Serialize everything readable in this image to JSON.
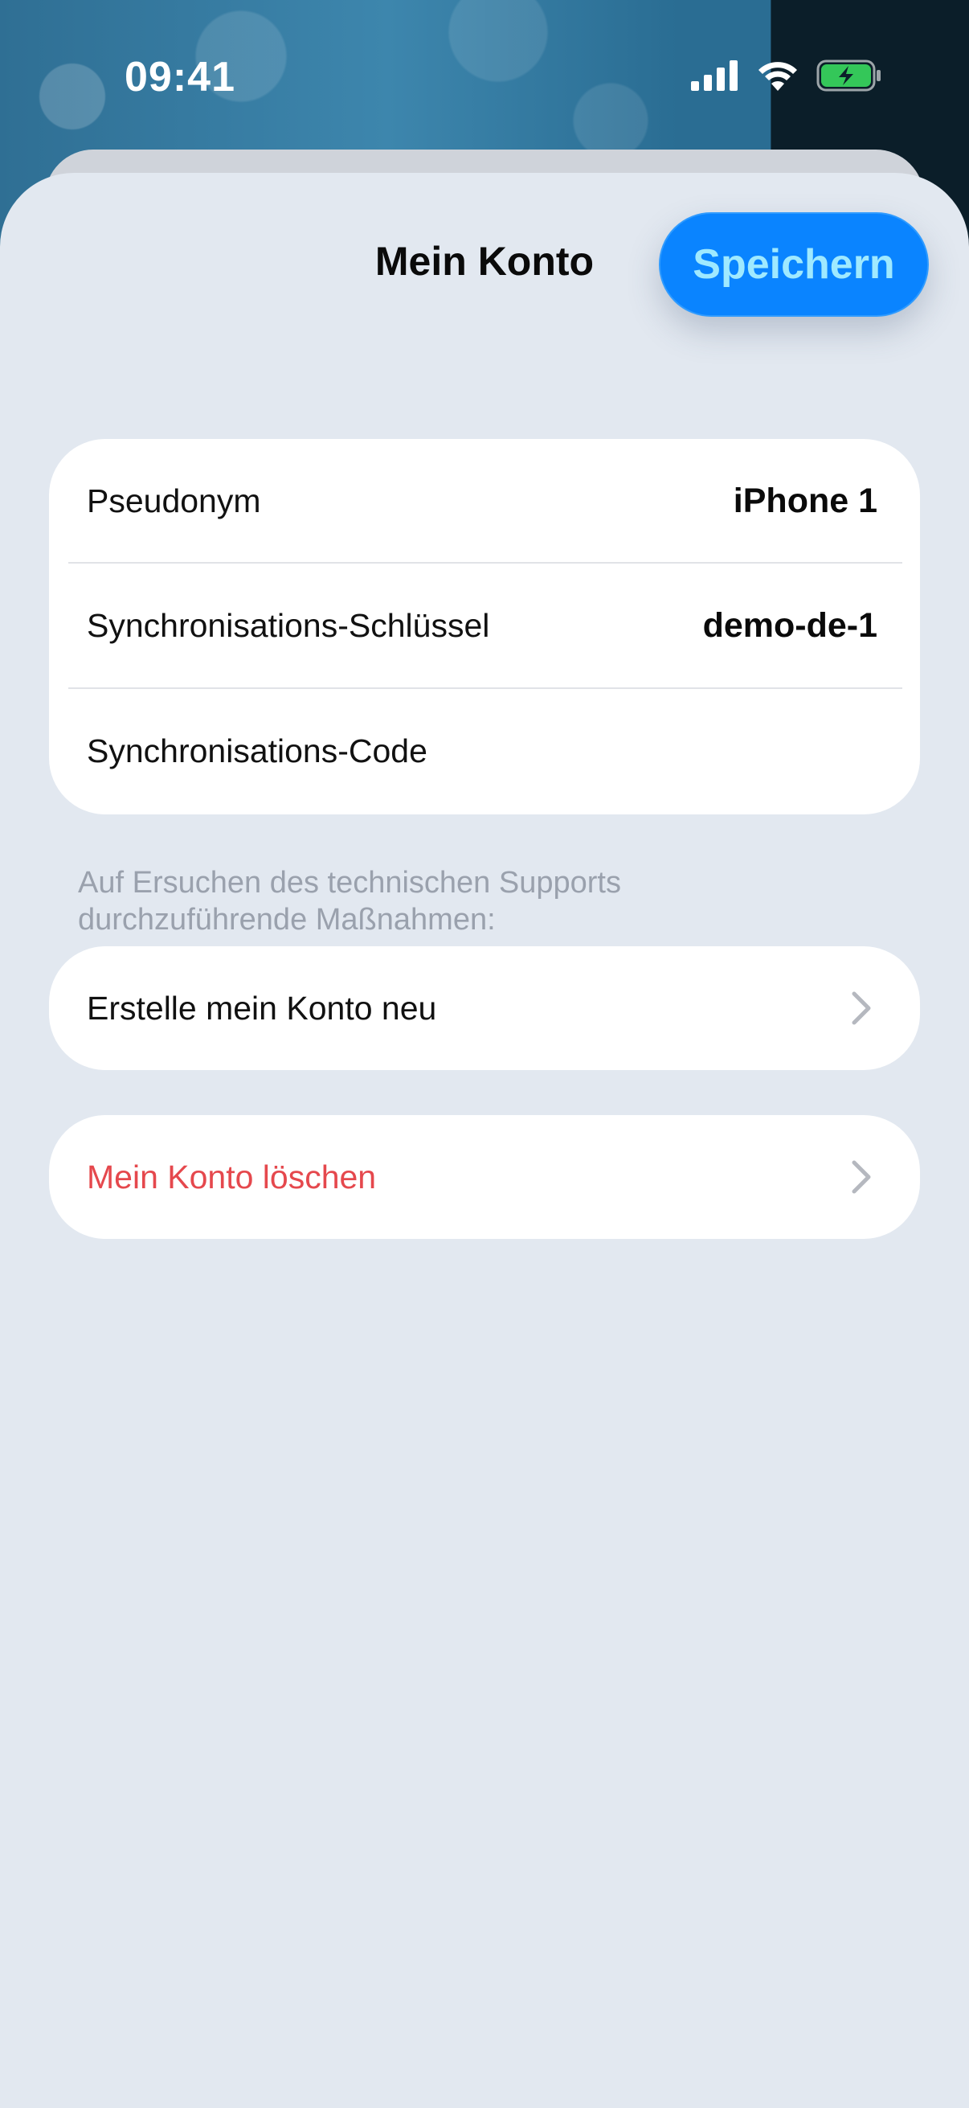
{
  "status_bar": {
    "time": "09:41",
    "icons": [
      "cellular-signal-icon",
      "wifi-icon",
      "battery-charging-icon"
    ]
  },
  "sheet": {
    "title": "Mein Konto",
    "save_label": "Speichern"
  },
  "info_rows": [
    {
      "label": "Pseudonym",
      "value": "iPhone 1"
    },
    {
      "label": "Synchronisations-Schlüssel",
      "value": "demo-de-1"
    },
    {
      "label": "Synchronisations-Code",
      "value": ""
    }
  ],
  "support_section": {
    "caption_line1": "Auf Ersuchen des technischen Supports",
    "caption_line2": "durchzuführende Maßnahmen:"
  },
  "actions": {
    "recreate_account": "Erstelle mein Konto neu",
    "delete_account": "Mein Konto löschen"
  },
  "colors": {
    "accent": "#0a84ff",
    "danger": "#e5484d",
    "sheet_background": "#e2e8f0"
  }
}
